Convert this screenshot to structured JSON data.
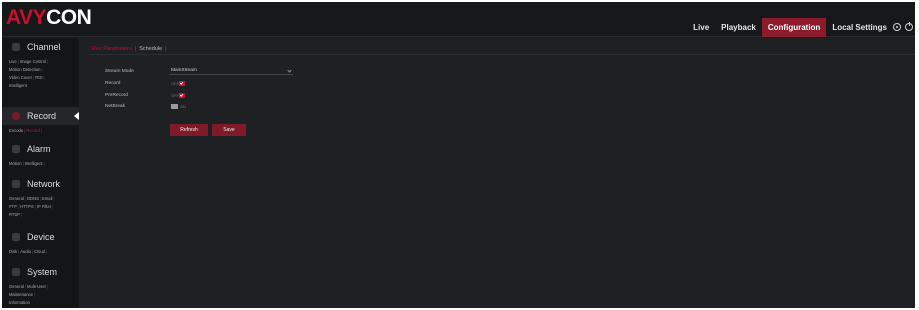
{
  "app": {
    "logo_part1": "AVY",
    "logo_part2": "CON"
  },
  "nav": {
    "items": [
      {
        "label": "Live"
      },
      {
        "label": "Playback"
      },
      {
        "label": "Configuration"
      },
      {
        "label": "Local Settings"
      }
    ],
    "active_index": 2
  },
  "sidebar": {
    "sections": [
      {
        "title": "Channel",
        "icon": "camera-icon",
        "links": [
          "Live",
          "Image Control",
          "Motion Detection",
          "Video Cover",
          "ROI",
          "Intelligent"
        ],
        "active_link": null
      },
      {
        "title": "Record",
        "icon": "record-icon",
        "links": [
          "Encode",
          "Record"
        ],
        "active_link": 1
      },
      {
        "title": "Alarm",
        "icon": "alarm-icon",
        "links": [
          "Motion",
          "Intelligent"
        ],
        "active_link": null
      },
      {
        "title": "Network",
        "icon": "network-icon",
        "links": [
          "General",
          "DDNS",
          "Email",
          "FTP",
          "HTTPS",
          "IP Filter",
          "RTSP"
        ],
        "active_link": null
      },
      {
        "title": "Device",
        "icon": "device-icon",
        "links": [
          "Disk",
          "Audio",
          "Cloud"
        ],
        "active_link": null
      },
      {
        "title": "System",
        "icon": "system-icon",
        "links": [
          "General",
          "Multi-User",
          "Maintenance",
          "Information"
        ],
        "active_link": null
      }
    ]
  },
  "main": {
    "tabs": [
      {
        "label": "Rec Parameters"
      },
      {
        "label": "Schedule"
      }
    ],
    "active_tab": 0,
    "form": {
      "stream_mode_label": "Stream Mode",
      "stream_mode_value": "MainStream",
      "record_label": "Record",
      "prerecord_label": "PreRecord",
      "network_label": "NetBreak",
      "toggle_off_text": "OFF",
      "toggle_on_text": "ON"
    },
    "buttons": {
      "refresh": "Refresh",
      "save": "Save"
    }
  },
  "colors": {
    "accent": "#c8102e",
    "button": "#7f1a28",
    "nav_active": "#8e1b2c",
    "background": "#1f2023",
    "sidebar": "#141517"
  }
}
